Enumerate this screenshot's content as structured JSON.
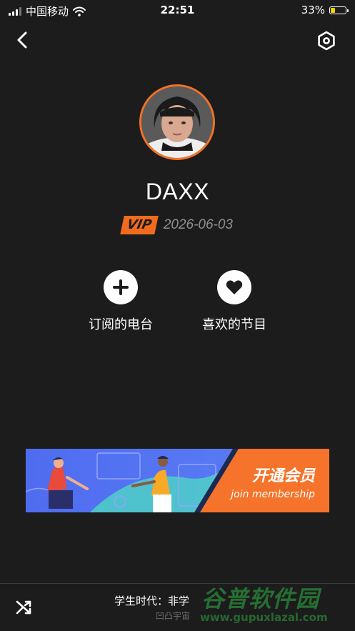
{
  "status_bar": {
    "carrier": "中国移动",
    "time": "22:51",
    "battery_percent": "33%",
    "battery_level": 0.33
  },
  "nav": {
    "back_icon": "chevron-left-icon",
    "settings_icon": "settings-hexagon-icon"
  },
  "profile": {
    "username": "DAXX",
    "vip_label": "VIP",
    "vip_date": "2026-06-03",
    "accent_color": "#f27226"
  },
  "actions": [
    {
      "label": "订阅的电台",
      "icon": "plus-icon"
    },
    {
      "label": "喜欢的节目",
      "icon": "heart-icon"
    }
  ],
  "banner": {
    "title": "开通会员",
    "subtitle": "join membership",
    "accent_color": "#f5732a"
  },
  "player": {
    "now_playing": "学生时代：非学",
    "subtitle": "凹凸宇宙",
    "shuffle_icon": "shuffle-icon"
  },
  "watermark": {
    "title": "谷普软件园",
    "url": "www.gupuxlazal.com"
  }
}
